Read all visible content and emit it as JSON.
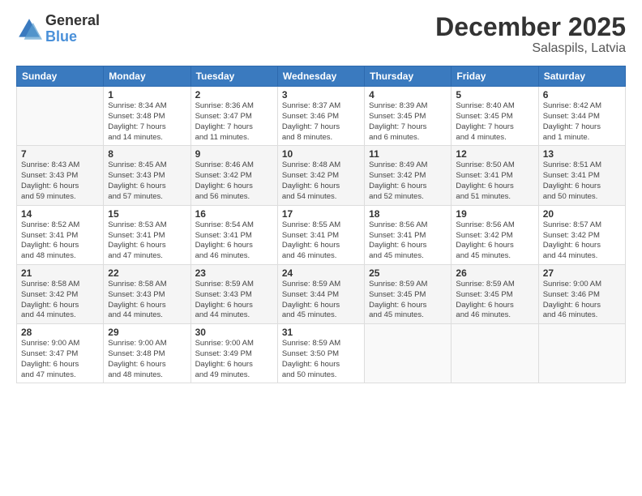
{
  "logo": {
    "general": "General",
    "blue": "Blue"
  },
  "title": "December 2025",
  "subtitle": "Salaspils, Latvia",
  "days_header": [
    "Sunday",
    "Monday",
    "Tuesday",
    "Wednesday",
    "Thursday",
    "Friday",
    "Saturday"
  ],
  "weeks": [
    [
      {
        "day": "",
        "info": ""
      },
      {
        "day": "1",
        "info": "Sunrise: 8:34 AM\nSunset: 3:48 PM\nDaylight: 7 hours\nand 14 minutes."
      },
      {
        "day": "2",
        "info": "Sunrise: 8:36 AM\nSunset: 3:47 PM\nDaylight: 7 hours\nand 11 minutes."
      },
      {
        "day": "3",
        "info": "Sunrise: 8:37 AM\nSunset: 3:46 PM\nDaylight: 7 hours\nand 8 minutes."
      },
      {
        "day": "4",
        "info": "Sunrise: 8:39 AM\nSunset: 3:45 PM\nDaylight: 7 hours\nand 6 minutes."
      },
      {
        "day": "5",
        "info": "Sunrise: 8:40 AM\nSunset: 3:45 PM\nDaylight: 7 hours\nand 4 minutes."
      },
      {
        "day": "6",
        "info": "Sunrise: 8:42 AM\nSunset: 3:44 PM\nDaylight: 7 hours\nand 1 minute."
      }
    ],
    [
      {
        "day": "7",
        "info": "Sunrise: 8:43 AM\nSunset: 3:43 PM\nDaylight: 6 hours\nand 59 minutes."
      },
      {
        "day": "8",
        "info": "Sunrise: 8:45 AM\nSunset: 3:43 PM\nDaylight: 6 hours\nand 57 minutes."
      },
      {
        "day": "9",
        "info": "Sunrise: 8:46 AM\nSunset: 3:42 PM\nDaylight: 6 hours\nand 56 minutes."
      },
      {
        "day": "10",
        "info": "Sunrise: 8:48 AM\nSunset: 3:42 PM\nDaylight: 6 hours\nand 54 minutes."
      },
      {
        "day": "11",
        "info": "Sunrise: 8:49 AM\nSunset: 3:42 PM\nDaylight: 6 hours\nand 52 minutes."
      },
      {
        "day": "12",
        "info": "Sunrise: 8:50 AM\nSunset: 3:41 PM\nDaylight: 6 hours\nand 51 minutes."
      },
      {
        "day": "13",
        "info": "Sunrise: 8:51 AM\nSunset: 3:41 PM\nDaylight: 6 hours\nand 50 minutes."
      }
    ],
    [
      {
        "day": "14",
        "info": "Sunrise: 8:52 AM\nSunset: 3:41 PM\nDaylight: 6 hours\nand 48 minutes."
      },
      {
        "day": "15",
        "info": "Sunrise: 8:53 AM\nSunset: 3:41 PM\nDaylight: 6 hours\nand 47 minutes."
      },
      {
        "day": "16",
        "info": "Sunrise: 8:54 AM\nSunset: 3:41 PM\nDaylight: 6 hours\nand 46 minutes."
      },
      {
        "day": "17",
        "info": "Sunrise: 8:55 AM\nSunset: 3:41 PM\nDaylight: 6 hours\nand 46 minutes."
      },
      {
        "day": "18",
        "info": "Sunrise: 8:56 AM\nSunset: 3:41 PM\nDaylight: 6 hours\nand 45 minutes."
      },
      {
        "day": "19",
        "info": "Sunrise: 8:56 AM\nSunset: 3:42 PM\nDaylight: 6 hours\nand 45 minutes."
      },
      {
        "day": "20",
        "info": "Sunrise: 8:57 AM\nSunset: 3:42 PM\nDaylight: 6 hours\nand 44 minutes."
      }
    ],
    [
      {
        "day": "21",
        "info": "Sunrise: 8:58 AM\nSunset: 3:42 PM\nDaylight: 6 hours\nand 44 minutes."
      },
      {
        "day": "22",
        "info": "Sunrise: 8:58 AM\nSunset: 3:43 PM\nDaylight: 6 hours\nand 44 minutes."
      },
      {
        "day": "23",
        "info": "Sunrise: 8:59 AM\nSunset: 3:43 PM\nDaylight: 6 hours\nand 44 minutes."
      },
      {
        "day": "24",
        "info": "Sunrise: 8:59 AM\nSunset: 3:44 PM\nDaylight: 6 hours\nand 45 minutes."
      },
      {
        "day": "25",
        "info": "Sunrise: 8:59 AM\nSunset: 3:45 PM\nDaylight: 6 hours\nand 45 minutes."
      },
      {
        "day": "26",
        "info": "Sunrise: 8:59 AM\nSunset: 3:45 PM\nDaylight: 6 hours\nand 46 minutes."
      },
      {
        "day": "27",
        "info": "Sunrise: 9:00 AM\nSunset: 3:46 PM\nDaylight: 6 hours\nand 46 minutes."
      }
    ],
    [
      {
        "day": "28",
        "info": "Sunrise: 9:00 AM\nSunset: 3:47 PM\nDaylight: 6 hours\nand 47 minutes."
      },
      {
        "day": "29",
        "info": "Sunrise: 9:00 AM\nSunset: 3:48 PM\nDaylight: 6 hours\nand 48 minutes."
      },
      {
        "day": "30",
        "info": "Sunrise: 9:00 AM\nSunset: 3:49 PM\nDaylight: 6 hours\nand 49 minutes."
      },
      {
        "day": "31",
        "info": "Sunrise: 8:59 AM\nSunset: 3:50 PM\nDaylight: 6 hours\nand 50 minutes."
      },
      {
        "day": "",
        "info": ""
      },
      {
        "day": "",
        "info": ""
      },
      {
        "day": "",
        "info": ""
      }
    ]
  ]
}
